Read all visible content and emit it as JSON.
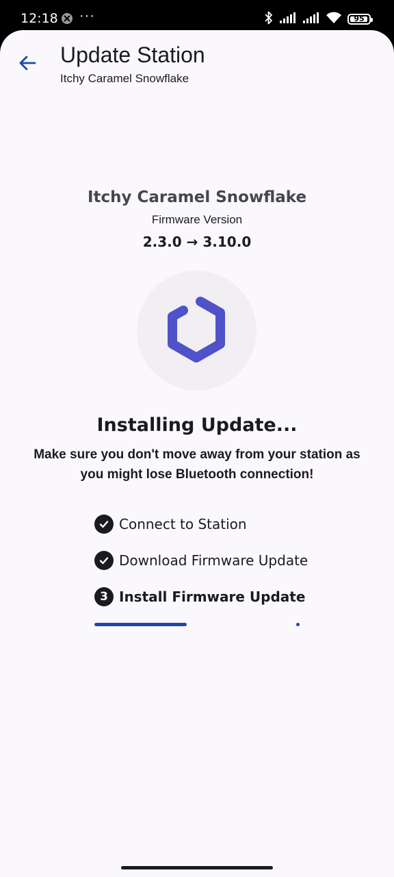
{
  "status_bar": {
    "time": "12:18",
    "more_indicator": "···",
    "battery_level": "95",
    "icons": [
      "notification-icon",
      "bluetooth-icon",
      "signal-icon",
      "signal-icon",
      "wifi-icon",
      "battery-icon"
    ]
  },
  "app_bar": {
    "title": "Update Station",
    "subtitle": "Itchy Caramel Snowflake",
    "back_icon": "arrow-back-icon"
  },
  "device": {
    "name": "Itchy Caramel Snowflake",
    "firmware_label": "Firmware Version",
    "firmware_versions": "2.3.0 → 3.10.0"
  },
  "logo": {
    "icon": "hexagon-logo-icon",
    "color": "#4f52c8"
  },
  "install": {
    "title": "Installing Update...",
    "warning": "Make sure you don't move away from your station as you might lose Bluetooth connection!"
  },
  "steps": [
    {
      "label": "Connect to Station",
      "status": "done",
      "icon": "check-circle-icon"
    },
    {
      "label": "Download Firmware Update",
      "status": "done",
      "icon": "check-circle-icon"
    },
    {
      "label": "Install Firmware Update",
      "status": "active",
      "number": "3"
    }
  ],
  "progress": {
    "fraction": 0.45,
    "color": "#1e48a8"
  },
  "colors": {
    "background": "#fbf8fd",
    "accent": "#1e48a8",
    "text": "#1b1b1f"
  }
}
